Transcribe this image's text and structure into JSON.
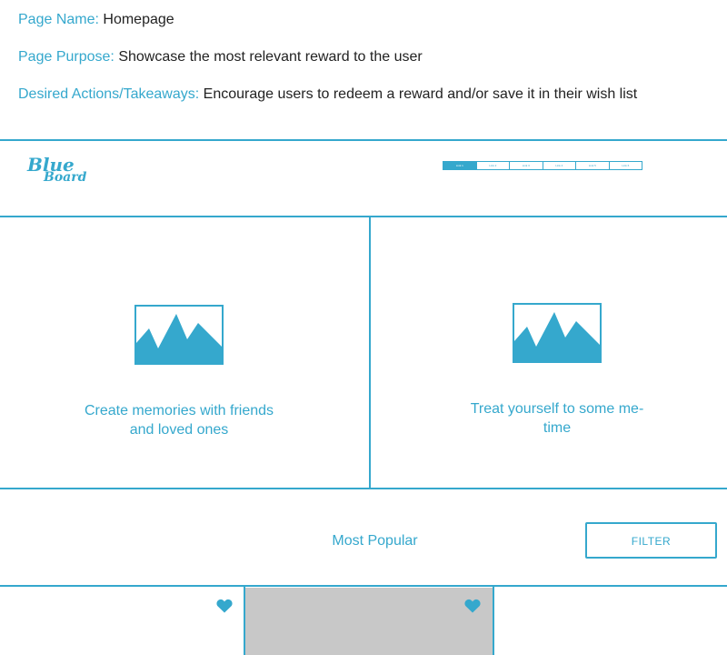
{
  "meta": [
    {
      "key": "Page Name:",
      "value": "Homepage"
    },
    {
      "key": "Page Purpose:",
      "value": "Showcase the most relevant reward to the user"
    },
    {
      "key": "Desired Actions/Takeaways:",
      "value": "Encourage users to redeem a reward and/or save it in their wish list"
    }
  ],
  "header": {
    "logo_text": [
      "Blue",
      "Board"
    ],
    "nav_links": [
      "Link 1",
      "Link 2",
      "Link 3",
      "Link 4",
      "Link 5",
      "Link 6"
    ],
    "active_index": 0
  },
  "hero": {
    "items": [
      {
        "caption_line1": "Create memories with friends",
        "caption_line2": "and loved ones",
        "icon": "landscape-image-icon"
      },
      {
        "caption_line1": "Treat yourself to some me-",
        "caption_line2": "time",
        "icon": "landscape-image-icon"
      }
    ]
  },
  "popular": {
    "title": "Most Popular",
    "filter_label": "FILTER"
  },
  "cards": [
    {
      "icon": "heart-icon",
      "placeholder": false
    },
    {
      "icon": "heart-icon",
      "placeholder": true
    },
    {
      "icon": "",
      "placeholder": false
    }
  ],
  "colors": {
    "accent": "#35a8cd",
    "placeholder": "#c8c8c8",
    "text": "#222222"
  }
}
